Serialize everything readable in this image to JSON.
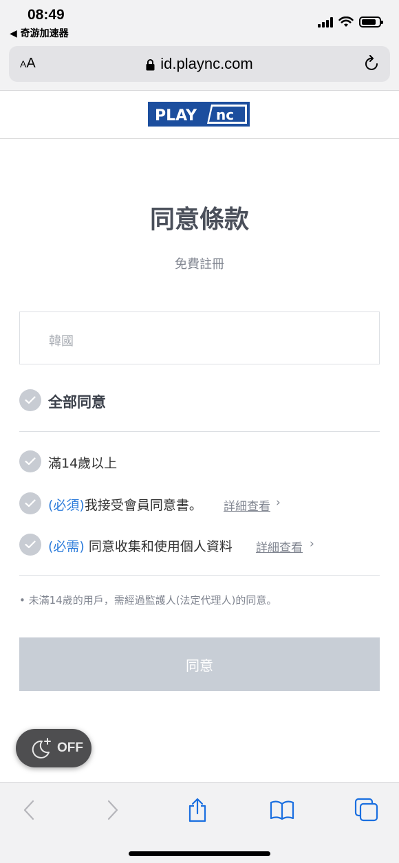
{
  "status_bar": {
    "time": "08:49",
    "back_app": "◀ 奇游加速器"
  },
  "browser": {
    "aa_small": "A",
    "aa_large": "A",
    "url": "id.plaync.com"
  },
  "logo": {
    "left_text": "PLAY",
    "right_text": "nc"
  },
  "page": {
    "title": "同意條款",
    "subtitle": "免費註冊",
    "country_placeholder": "韓國",
    "agree_all": "全部同意",
    "items": [
      {
        "prefix": "",
        "label": "滿14歲以上"
      },
      {
        "prefix": "(必須)",
        "label": "我接受會員同意書。",
        "detail": "詳細查看"
      },
      {
        "prefix": "(必需)",
        "label": " 同意收集和使用個人資料",
        "detail": "詳細查看"
      }
    ],
    "note": "• 未滿14歲的用戶，需經過監護人(法定代理人)的同意。",
    "agree_button": "同意"
  },
  "night_mode": {
    "label": "OFF"
  },
  "colors": {
    "accent_blue": "#2e7ddb",
    "logo_blue": "#1c4e9e",
    "button_disabled": "#c8ced6",
    "check_gray": "#c8ccd3"
  }
}
